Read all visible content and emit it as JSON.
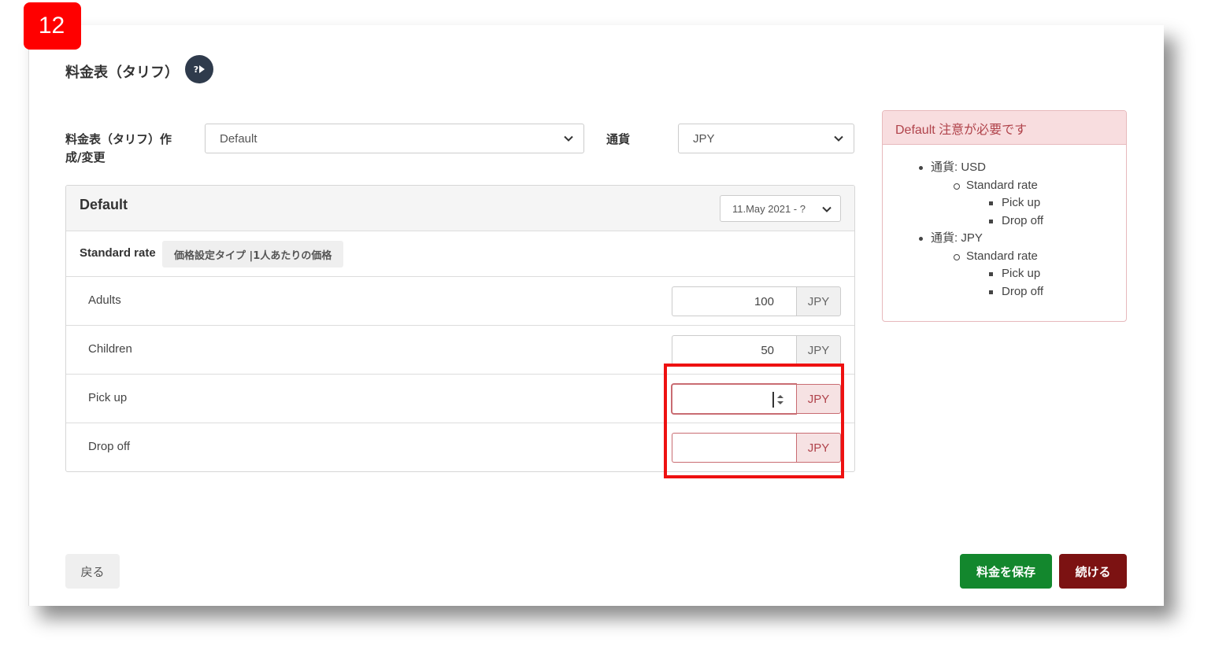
{
  "step_badge": "12",
  "page_title": "料金表（タリフ）",
  "help_button_icon": "help-play-icon",
  "help_button_text": "?",
  "tariff_select": {
    "label": "料金表（タリフ）作成/変更",
    "label_line1": "料金表（タリフ）作",
    "label_line2": "成/変更",
    "value": "Default"
  },
  "currency_select": {
    "label": "通貨",
    "value": "JPY"
  },
  "card": {
    "title": "Default",
    "date_range": "11.May 2021 - ?",
    "rate_name": "Standard rate",
    "pricing_type": "価格設定タイプ |1人あたりの価格",
    "rows": [
      {
        "label": "Adults",
        "value": "100",
        "currency": "JPY",
        "state": "normal"
      },
      {
        "label": "Children",
        "value": "50",
        "currency": "JPY",
        "state": "normal"
      },
      {
        "label": "Pick up",
        "value": "",
        "currency": "JPY",
        "state": "error"
      },
      {
        "label": "Drop off",
        "value": "",
        "currency": "JPY",
        "state": "error"
      }
    ]
  },
  "warning": {
    "title": "Default 注意が必要です",
    "items": [
      {
        "currency": "通貨: USD",
        "rate": "Standard rate",
        "fields": [
          "Pick up",
          "Drop off"
        ]
      },
      {
        "currency": "通貨: JPY",
        "rate": "Standard rate",
        "fields": [
          "Pick up",
          "Drop off"
        ]
      }
    ]
  },
  "buttons": {
    "back": "戻る",
    "save": "料金を保存",
    "continue": "続ける"
  },
  "colors": {
    "save": "#13872d",
    "continue": "#7c1212",
    "error": "#b0434b",
    "highlight": "#ee1111",
    "badge": "#ff0000"
  }
}
